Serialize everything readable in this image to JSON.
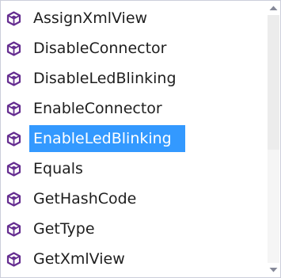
{
  "list": {
    "items": [
      {
        "label": "AssignXmlView",
        "icon": "method-cube-icon"
      },
      {
        "label": "DisableConnector",
        "icon": "method-cube-icon"
      },
      {
        "label": "DisableLedBlinking",
        "icon": "method-cube-icon"
      },
      {
        "label": "EnableConnector",
        "icon": "method-cube-icon"
      },
      {
        "label": "EnableLedBlinking",
        "icon": "method-cube-icon",
        "selected": true
      },
      {
        "label": "Equals",
        "icon": "method-cube-icon"
      },
      {
        "label": "GetHashCode",
        "icon": "method-cube-icon"
      },
      {
        "label": "GetType",
        "icon": "method-cube-icon"
      },
      {
        "label": "GetXmlView",
        "icon": "method-cube-icon"
      }
    ],
    "selected_index": 4
  },
  "scrollbar": {
    "up_icon": "scroll-up-arrow-icon",
    "down_icon": "scroll-down-arrow-icon",
    "position_fraction": 0.0
  },
  "colors": {
    "selection": "#3399ff",
    "icon": "#652d90",
    "text": "#1e1e1e",
    "selected_text": "#ffffff",
    "border": "#cccedb"
  }
}
